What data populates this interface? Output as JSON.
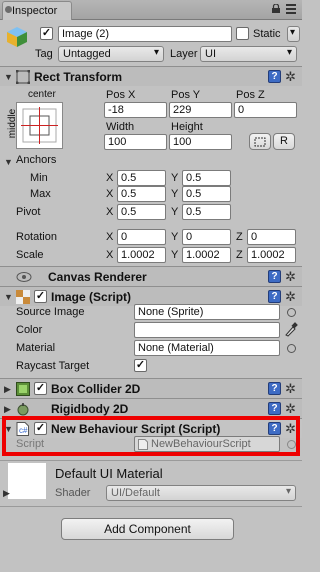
{
  "window": {
    "tab_label": "Inspector"
  },
  "gameobject": {
    "active": true,
    "name": "Image (2)",
    "static_label": "Static",
    "static_checked": false,
    "tag_label": "Tag",
    "tag_value": "Untagged",
    "layer_label": "Layer",
    "layer_value": "UI"
  },
  "rect_transform": {
    "title": "Rect Transform",
    "anchor_preset_top": "center",
    "anchor_preset_side": "middle",
    "posx_label": "Pos X",
    "posx": "-18",
    "posy_label": "Pos Y",
    "posy": "229",
    "posz_label": "Pos Z",
    "posz": "0",
    "width_label": "Width",
    "width": "100",
    "height_label": "Height",
    "height": "100",
    "r_button": "R",
    "anchors_label": "Anchors",
    "min_label": "Min",
    "min_x": "0.5",
    "min_y": "0.5",
    "max_label": "Max",
    "max_x": "0.5",
    "max_y": "0.5",
    "pivot_label": "Pivot",
    "pivot_x": "0.5",
    "pivot_y": "0.5",
    "rotation_label": "Rotation",
    "rot_x": "0",
    "rot_y": "0",
    "rot_z": "0",
    "scale_label": "Scale",
    "scale_x": "1.0002",
    "scale_y": "1.0002",
    "scale_z": "1.0002",
    "x": "X",
    "y": "Y",
    "z": "Z"
  },
  "canvas_renderer": {
    "title": "Canvas Renderer"
  },
  "image": {
    "title": "Image (Script)",
    "enabled": true,
    "source_label": "Source Image",
    "source_value": "None (Sprite)",
    "color_label": "Color",
    "color_value": "#ffffff",
    "material_label": "Material",
    "material_value": "None (Material)",
    "raycast_label": "Raycast Target",
    "raycast_checked": true
  },
  "box_collider": {
    "title": "Box Collider 2D"
  },
  "rigidbody": {
    "title": "Rigidbody 2D"
  },
  "new_behaviour": {
    "title": "New Behaviour Script (Script)",
    "enabled": true,
    "script_label": "Script",
    "script_value": "NewBehaviourScript",
    "highlight_color": "#ee0000"
  },
  "material": {
    "name": "Default UI Material",
    "shader_label": "Shader",
    "shader_value": "UI/Default"
  },
  "footer": {
    "add_component": "Add Component"
  },
  "glyphs": {
    "check": "✓",
    "help": "?",
    "gear": "✲",
    "fold_open": "▼",
    "fold_closed": "▶"
  }
}
